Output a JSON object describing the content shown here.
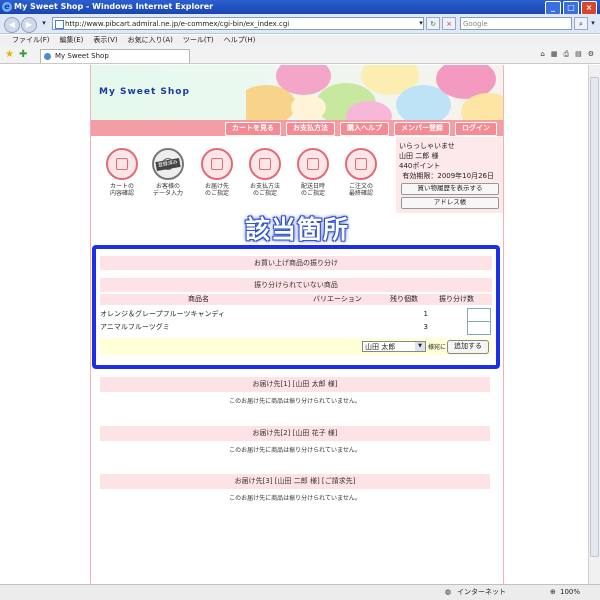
{
  "browser": {
    "title": "My Sweet Shop - Windows Internet Explorer",
    "url": "http://www.pibcart.admiral.ne.jp/e-commex/cgi-bin/ex_index.cgi",
    "search_placeholder": "Google",
    "menu": [
      "ファイル(F)",
      "編集(E)",
      "表示(V)",
      "お気に入り(A)",
      "ツール(T)",
      "ヘルプ(H)"
    ],
    "tab_title": "My Sweet Shop",
    "status_zone": "インターネット",
    "zoom": "100%"
  },
  "shop": {
    "name": "My Sweet Shop",
    "nav": [
      "カートを見る",
      "お支払方法",
      "購入ヘルプ",
      "メンバー登録",
      "ログイン"
    ],
    "steps": [
      {
        "label": "カートの\n内容確認",
        "done": false
      },
      {
        "label": "お客様の\nデータ入力",
        "done": true,
        "stamp": "登録済み"
      },
      {
        "label": "お届け先\nのご指定",
        "done": false
      },
      {
        "label": "お支払方法\nのご指定",
        "done": false
      },
      {
        "label": "配送日時\nのご指定",
        "done": false
      },
      {
        "label": "ご注文の\n最終確認",
        "done": false
      }
    ]
  },
  "user": {
    "greeting": "いらっしゃいませ",
    "name": "山田 二郎 様",
    "points": "440ポイント",
    "expiry": "有効期限：2009年10月26日",
    "history_button": "買い物履歴を表示する",
    "address_button": "アドレス帳"
  },
  "callout": "該当箇所",
  "distribution": {
    "title": "お買い上げ商品の振り分け",
    "unassigned_title": "振り分けられていない商品",
    "columns": {
      "product": "商品名",
      "variation": "バリエーション",
      "remaining": "残り個数",
      "assign_qty": "振り分け数"
    },
    "rows": [
      {
        "product": "オレンジ＆グレープフルーツキャンディ",
        "variation": "",
        "remaining": "1"
      },
      {
        "product": "アニマルフルーツグミ",
        "variation": "",
        "remaining": "3"
      }
    ],
    "recipient_selected": "山田 太郎",
    "sama_label": "様宛に",
    "add_button": "追加する"
  },
  "destinations": [
    {
      "title": "お届け先[1] [山田 太郎 様]",
      "message": "このお届け先に商品は振り分けられていません。"
    },
    {
      "title": "お届け先[2] [山田 花子 様]",
      "message": "このお届け先に商品は振り分けられていません。"
    },
    {
      "title": "お届け先[3] [山田 二郎 様] [ご請求先]",
      "message": "このお届け先に商品は振り分けられていません。"
    }
  ]
}
